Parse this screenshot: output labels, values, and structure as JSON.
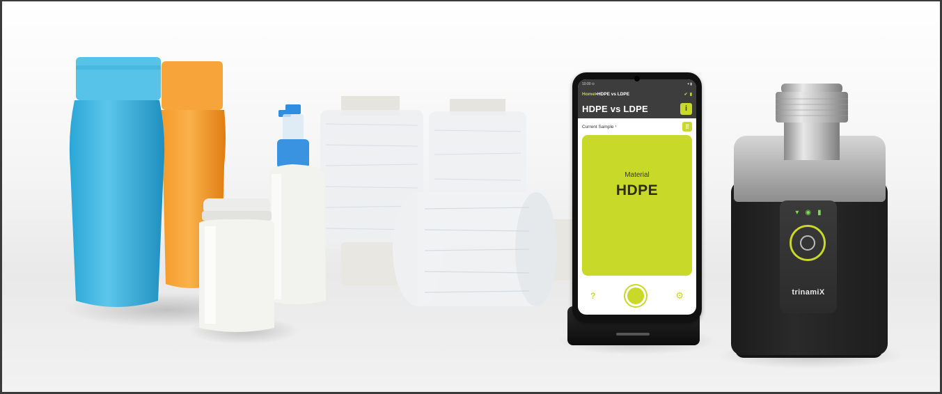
{
  "phone_app": {
    "status_time": "10:00 ⊙",
    "status_icons": "▾ ▮",
    "breadcrumb_home": "Home",
    "breadcrumb_sep": " > ",
    "breadcrumb_current": "HDPE vs LDPE",
    "title": "HDPE vs LDPE",
    "info_icon": "info-icon",
    "current_sample_label": "Current Sample",
    "current_sample_chevron": "›",
    "result_label": "Material",
    "result_value": "HDPE",
    "help_glyph": "?",
    "settings_glyph": "⚙",
    "accent_color": "#c8d92a",
    "header_color": "#3d3d3d"
  },
  "device": {
    "brand": "trinamiX",
    "led_glyphs": [
      "▾",
      "◉",
      "▮"
    ],
    "led_color": "#7ed957"
  },
  "scene": {
    "objects": [
      "blue-bottle-icon",
      "orange-bottle-icon",
      "spray-bottle-icon",
      "white-jar-icon",
      "film-roll-icon",
      "smartphone-icon",
      "spectrometer-icon"
    ]
  }
}
